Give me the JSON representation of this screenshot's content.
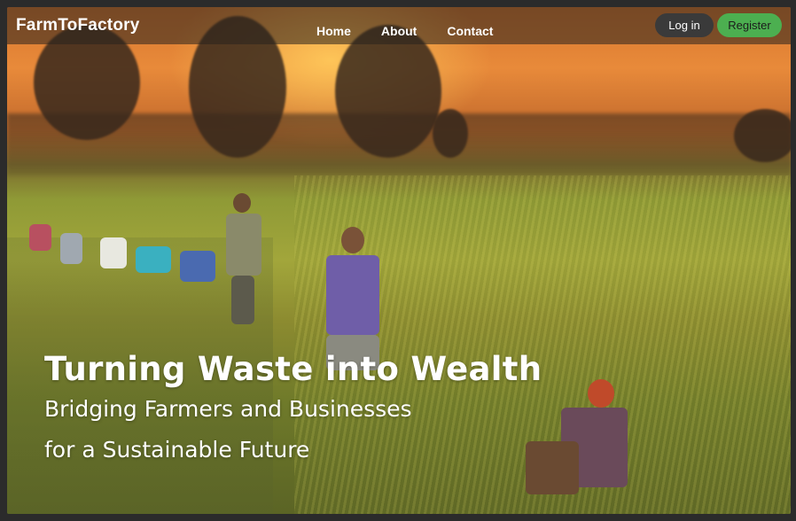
{
  "brand": {
    "name": "FarmToFactory"
  },
  "nav": {
    "links": [
      {
        "label": "Home"
      },
      {
        "label": "About"
      },
      {
        "label": "Contact"
      }
    ]
  },
  "auth": {
    "login_label": "Log in",
    "register_label": "Register"
  },
  "hero": {
    "title": "Turning Waste into Wealth",
    "subtitle_line1": "Bridging Farmers and Businesses",
    "subtitle_line2": "for a Sustainable Future"
  },
  "colors": {
    "register_bg": "#4caf50",
    "login_bg": "#3a3a3a",
    "navbar_bg": "rgba(40,35,30,0.55)"
  }
}
